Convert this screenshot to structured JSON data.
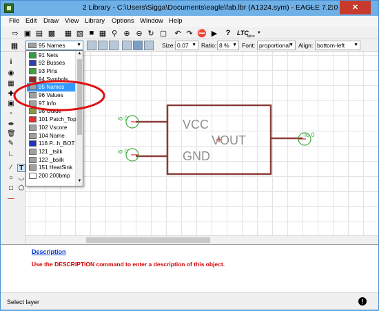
{
  "window": {
    "title": "2 Library - C:\\Users\\Sigga\\Documents\\eagle\\fab.lbr (A1324.sym) - EAGLE 7.2.0"
  },
  "menu": [
    "File",
    "Edit",
    "Draw",
    "View",
    "Library",
    "Options",
    "Window",
    "Help"
  ],
  "toolbar": {
    "ltc_label": "LTC",
    "ltc_sub": "spice"
  },
  "props": {
    "layer_value": "95 Names",
    "size_label": "Size:",
    "size_value": "0.07",
    "ratio_label": "Ratio:",
    "ratio_value": "8 %",
    "font_label": "Font:",
    "font_value": "proportional",
    "align_label": "Align:",
    "align_value": "bottom-left"
  },
  "layers": [
    {
      "label": "91 Nets",
      "color": "#2ea043"
    },
    {
      "label": "92 Busses",
      "color": "#3040b0"
    },
    {
      "label": "93 Pins",
      "color": "#3aa63a"
    },
    {
      "label": "94 Symbols",
      "color": "#8b2a2a"
    },
    {
      "label": "95 Names",
      "color": "#a0a0a0"
    },
    {
      "label": "96 Values",
      "color": "#a0a0a0"
    },
    {
      "label": "97 Info",
      "color": "#a0a0a0"
    },
    {
      "label": "98 Guide",
      "color": "#8a9a3a"
    },
    {
      "label": "101 Patch_Top",
      "color": "#e03030"
    },
    {
      "label": "102 Vscore",
      "color": "#a0a0a0"
    },
    {
      "label": "104 Name",
      "color": "#a0a0a0"
    },
    {
      "label": "116 P...h_BOT",
      "color": "#2030c0"
    },
    {
      "label": "121 _tsilk",
      "color": "#a0a0a0"
    },
    {
      "label": "122 _bsilk",
      "color": "#a0a0a0"
    },
    {
      "label": "151 HeatSink",
      "color": "#a0a0a0"
    },
    {
      "label": "200 200bmp",
      "color": "#ffffff"
    }
  ],
  "symbol": {
    "vcc": "VCC",
    "gnd": "GND",
    "vout": "VOUT",
    "pin_vcc": "io 0",
    "pin_gnd": "io 0",
    "pin_vout": "io 0"
  },
  "description": {
    "heading": "Description",
    "text": "Use the DESCRIPTION command to enter a description of this object."
  },
  "status": {
    "text": "Select layer"
  },
  "colors": {
    "symbol_outline": "#8b3a3a",
    "pin": "#3caa3c",
    "annotation": "#cc0000",
    "name_text": "#8f8f8f"
  }
}
